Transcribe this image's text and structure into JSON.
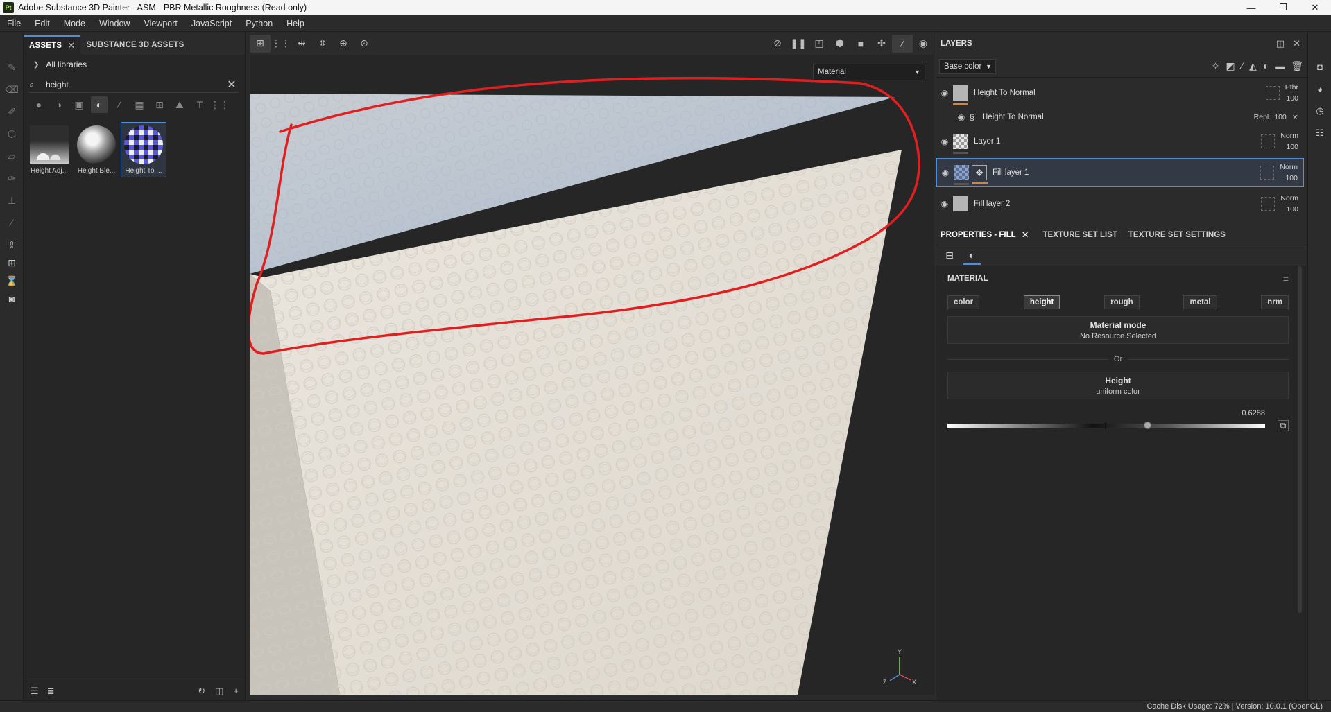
{
  "window": {
    "title": "Adobe Substance 3D Painter - ASM - PBR Metallic Roughness (Read only)",
    "logo": "Pt",
    "min": "—",
    "max": "❐",
    "close": "✕"
  },
  "menu": [
    "File",
    "Edit",
    "Mode",
    "Window",
    "Viewport",
    "JavaScript",
    "Python",
    "Help"
  ],
  "assets": {
    "tab_assets": "ASSETS",
    "tab_substance": "SUBSTANCE 3D ASSETS",
    "all_libraries": "All libraries",
    "search_value": "height",
    "items": [
      {
        "label": "Height Adj...",
        "kind": "adj"
      },
      {
        "label": "Height Ble...",
        "kind": "blend"
      },
      {
        "label": "Height To ...",
        "kind": "ton"
      }
    ]
  },
  "viewport": {
    "material_select": "Material",
    "axis_y": "Y",
    "axis_z": "Z",
    "axis_x": "X",
    "annotation_color": "#e02020"
  },
  "layers": {
    "title": "LAYERS",
    "channel": "Base color",
    "rows": [
      {
        "name": "Height To Normal",
        "blend": "Pthr",
        "opacity": "100"
      },
      {
        "name": "Height To Normal",
        "blend": "Repl",
        "opacity": "100"
      },
      {
        "name": "Layer 1",
        "blend": "Norm",
        "opacity": "100"
      },
      {
        "name": "Fill layer 1",
        "blend": "Norm",
        "opacity": "100"
      },
      {
        "name": "Fill layer 2",
        "blend": "Norm",
        "opacity": "100"
      }
    ]
  },
  "properties": {
    "tab_fill": "PROPERTIES - FILL",
    "tab_texset_list": "TEXTURE SET LIST",
    "tab_texset_settings": "TEXTURE SET SETTINGS",
    "section": "MATERIAL",
    "channels": [
      "color",
      "height",
      "rough",
      "metal",
      "nrm"
    ],
    "material_mode_title": "Material mode",
    "material_mode_value": "No Resource Selected",
    "or": "Or",
    "height_title": "Height",
    "height_value": "uniform color",
    "slider_value": "0.6288",
    "slider_fraction": 0.6288
  },
  "status": "Cache Disk Usage:    72% | Version: 10.0.1 (OpenGL)"
}
